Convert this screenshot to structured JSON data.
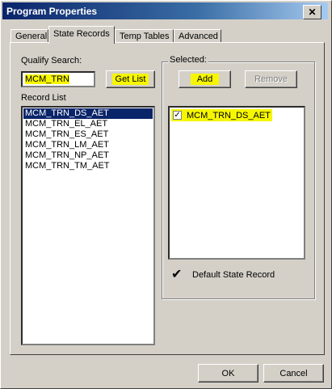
{
  "window": {
    "title": "Program Properties",
    "close_glyph": "✕"
  },
  "tabs": [
    {
      "label": "General",
      "active": false
    },
    {
      "label": "State Records",
      "active": true
    },
    {
      "label": "Temp Tables",
      "active": false
    },
    {
      "label": "Advanced",
      "active": false
    }
  ],
  "qualify": {
    "label": "Qualify Search:",
    "value": "MCM_TRN",
    "get_list_label": "Get List"
  },
  "record_list": {
    "label": "Record List",
    "items": [
      "MCM_TRN_DS_AET",
      "MCM_TRN_EL_AET",
      "MCM_TRN_ES_AET",
      "MCM_TRN_LM_AET",
      "MCM_TRN_NP_AET",
      "MCM_TRN_TM_AET"
    ],
    "selected_index": 0
  },
  "selected": {
    "label": "Selected:",
    "add_label": "Add",
    "remove_label": "Remove",
    "items": [
      {
        "name": "MCM_TRN_DS_AET",
        "checked": true
      }
    ],
    "checkbox_glyph": "✓",
    "default_label": "Default State Record",
    "default_glyph": "✔"
  },
  "footer": {
    "ok_label": "OK",
    "cancel_label": "Cancel"
  },
  "colors": {
    "highlight": "#f6f600",
    "selection": "#0a246a",
    "face": "#d4d0c8"
  }
}
